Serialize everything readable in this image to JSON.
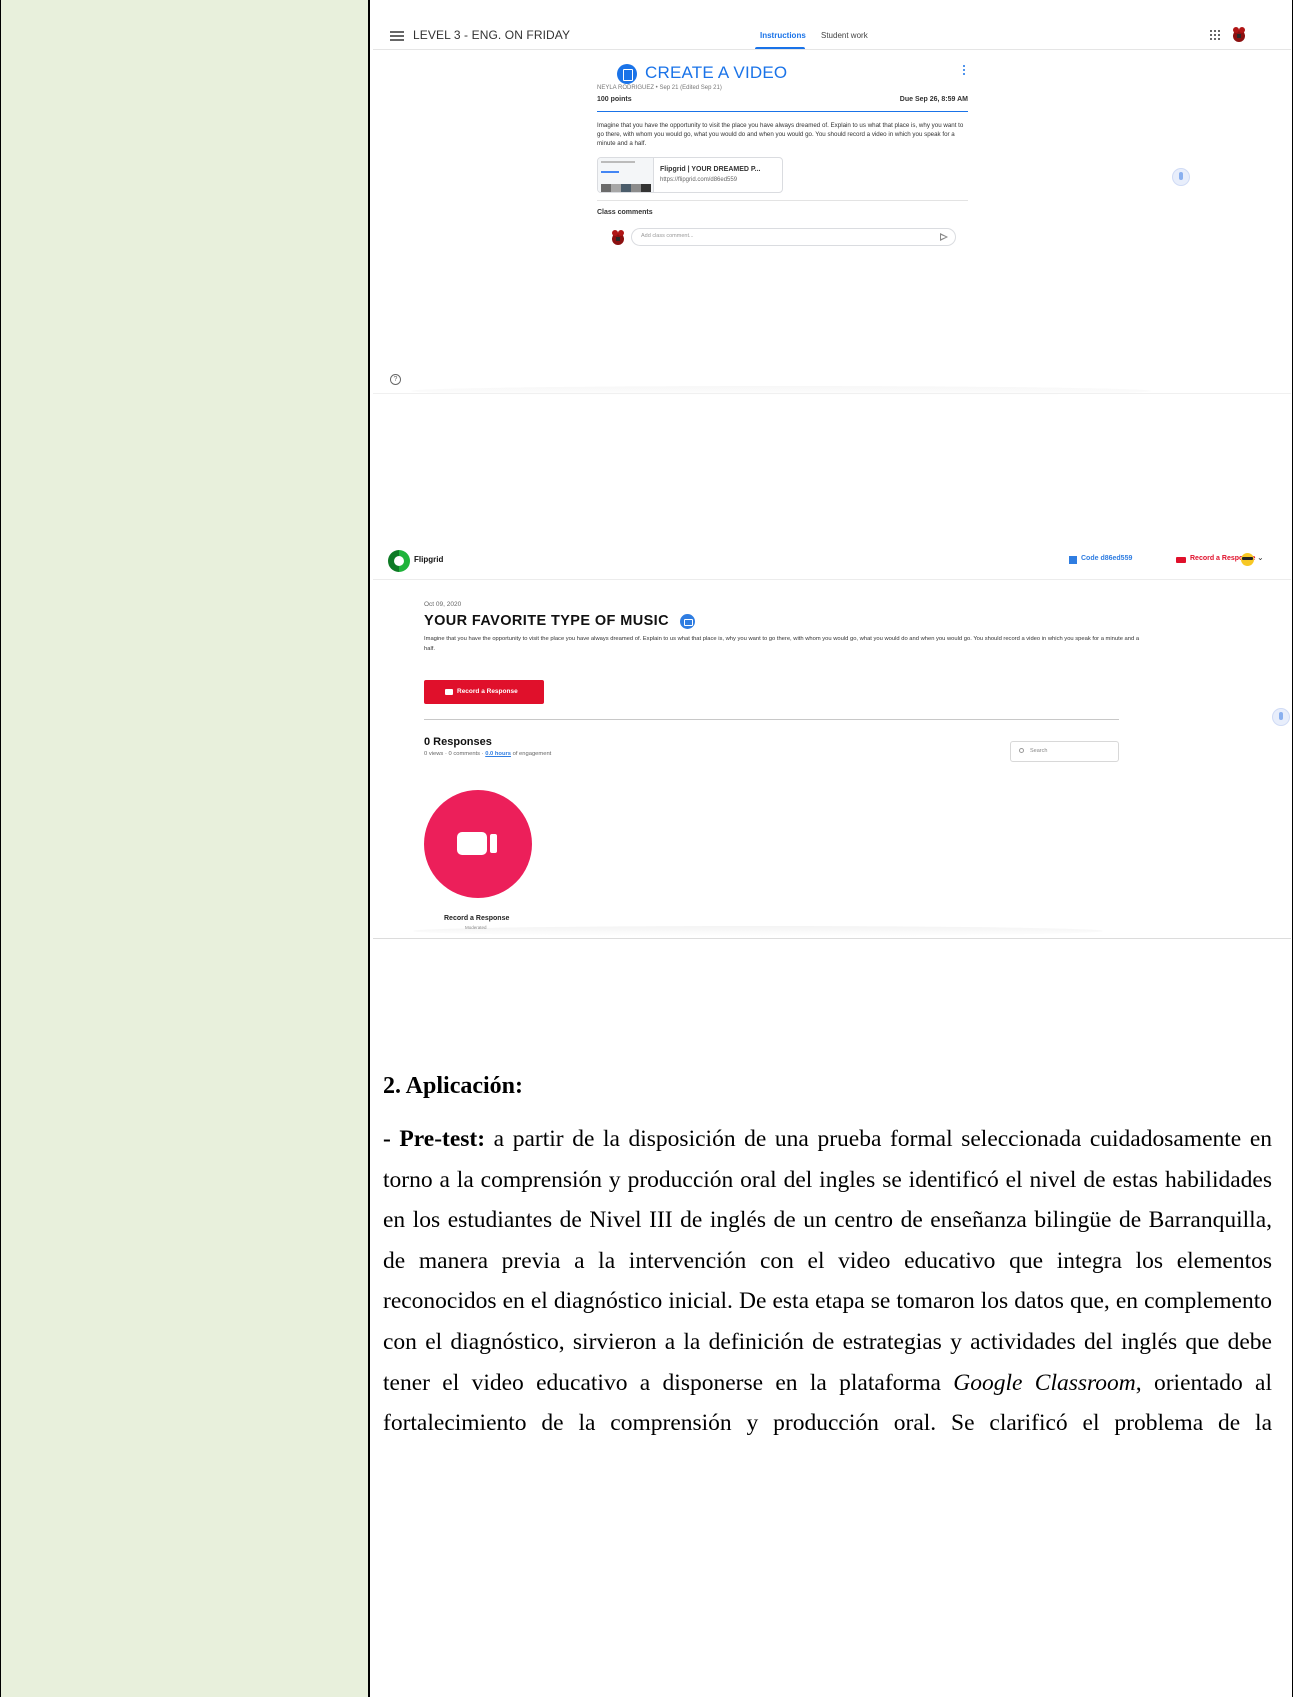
{
  "classroom": {
    "class_name": "LEVEL 3 - ENG. ON FRIDAY",
    "tabs": [
      {
        "label": "Instructions"
      },
      {
        "label": "Student work"
      }
    ],
    "assignment": {
      "title": "CREATE A VIDEO",
      "author_line": "NEYLA RODRIGUEZ • Sep 21 (Edited Sep 21)",
      "points": "100 points",
      "due": "Due Sep 26, 8:59 AM",
      "description": "Imagine that you have the opportunity to visit the place you have always dreamed of. Explain to us what that place is, why you want to go there, with whom you would go, what you would do and when you would go. You should record a video in which you speak for a minute and a half.",
      "attachment_title": "Flipgrid | YOUR DREAMED P...",
      "attachment_url": "https://flipgrid.com/d86ed559"
    },
    "comments_label": "Class comments",
    "comment_placeholder": "Add class comment...",
    "help_glyph": "?"
  },
  "flipgrid": {
    "brand": "Flipgrid",
    "code_label": "Code d86ed559",
    "record_header_label": "Record a Response",
    "date": "Oct 09, 2020",
    "topic_title": "YOUR FAVORITE TYPE OF MUSIC",
    "description": "Imagine that you have the opportunity to visit the place you have always dreamed of. Explain to us what that place is, why you want to go there, with whom you would go, what you would do and when you would go. You should record a video in which you speak for a minute and a half.",
    "record_button_label": "Record a Response",
    "responses_title": "0 Responses",
    "meta_prefix": "0 views · 0 comments · ",
    "meta_hours": "0.0 hours",
    "meta_suffix": " of engagement",
    "search_placeholder": "Search",
    "big_record_label": "Record a Response",
    "big_record_sub": "Moderated",
    "chevron": "⌄"
  },
  "document": {
    "section_heading": "2. Aplicación:",
    "lead_bold": "- Pre-test:",
    "text_1": " a partir de la disposición de una prueba formal seleccionada cuidadosamente en torno a la comprensión y producción oral del ingles se identificó el nivel de estas habilidades en los estudiantes de Nivel III de inglés de un centro de enseñanza bilingüe de Barranquilla, de manera previa a la intervención con el video educativo que integra los elementos reconocidos en el diagnóstico inicial. De esta etapa se tomaron los datos que, en complemento con el diagnóstico, sirvieron a la definición de estrategias y actividades del inglés que debe tener el video educativo a disponerse en la plataforma ",
    "italic": "Google Classroom",
    "text_2": ", orientado al fortalecimiento de la comprensión y producción oral. Se clarificó el problema de la"
  },
  "colors": {
    "classroom_blue": "#1a73e8",
    "flipgrid_red": "#e0102b",
    "record_circle": "#ec1f5a",
    "left_cell_fill": "#e8f0dc"
  }
}
